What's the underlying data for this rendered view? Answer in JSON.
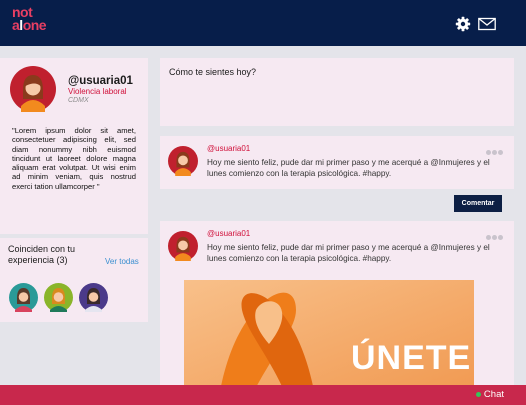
{
  "app": {
    "logo_line1": "not",
    "logo_line2_a": "a",
    "logo_line2_b": "l",
    "logo_line2_c": "one"
  },
  "header": {
    "icons": [
      "gear-icon",
      "mail-icon"
    ]
  },
  "profile": {
    "username": "@usuaria01",
    "category": "Violencia laboral",
    "city": "CDMX",
    "bio": "\"Lorem ipsum dolor sit amet, consectetuer adipiscing elit, sed diam nonummy nibh euismod tincidunt ut laoreet dolore magna aliquam erat volutpat. Ut wisi enim ad minim veniam, quis nostrud exerci tation ullamcorper \""
  },
  "matches": {
    "title": "Coinciden con tu experiencia (3)",
    "link": "Ver todas",
    "count": 3
  },
  "composer": {
    "placeholder": "Cómo te sientes hoy?"
  },
  "posts": [
    {
      "user": "@usuaria01",
      "text": "Hoy me siento feliz, pude dar mi primer paso y me acerqué a @Inmujeres y el lunes comienzo con la terapia psicológica. #happy."
    },
    {
      "user": "@usuaria01",
      "text": "Hoy me siento feliz, pude dar mi primer paso y me acerqué a @Inmujeres y el lunes comienzo con la terapia psicológica. #happy.",
      "banner_text": "ÚNETE"
    }
  ],
  "actions": {
    "comment_label": "Comentar"
  },
  "footer": {
    "chat_label": "Chat"
  },
  "colors": {
    "navy": "#071e4a",
    "pink": "#e83f63",
    "card": "#f6e9f2",
    "footer": "#c8284c",
    "accent_red": "#d0103a",
    "link_blue": "#3a8fd0",
    "online": "#37c45a"
  }
}
